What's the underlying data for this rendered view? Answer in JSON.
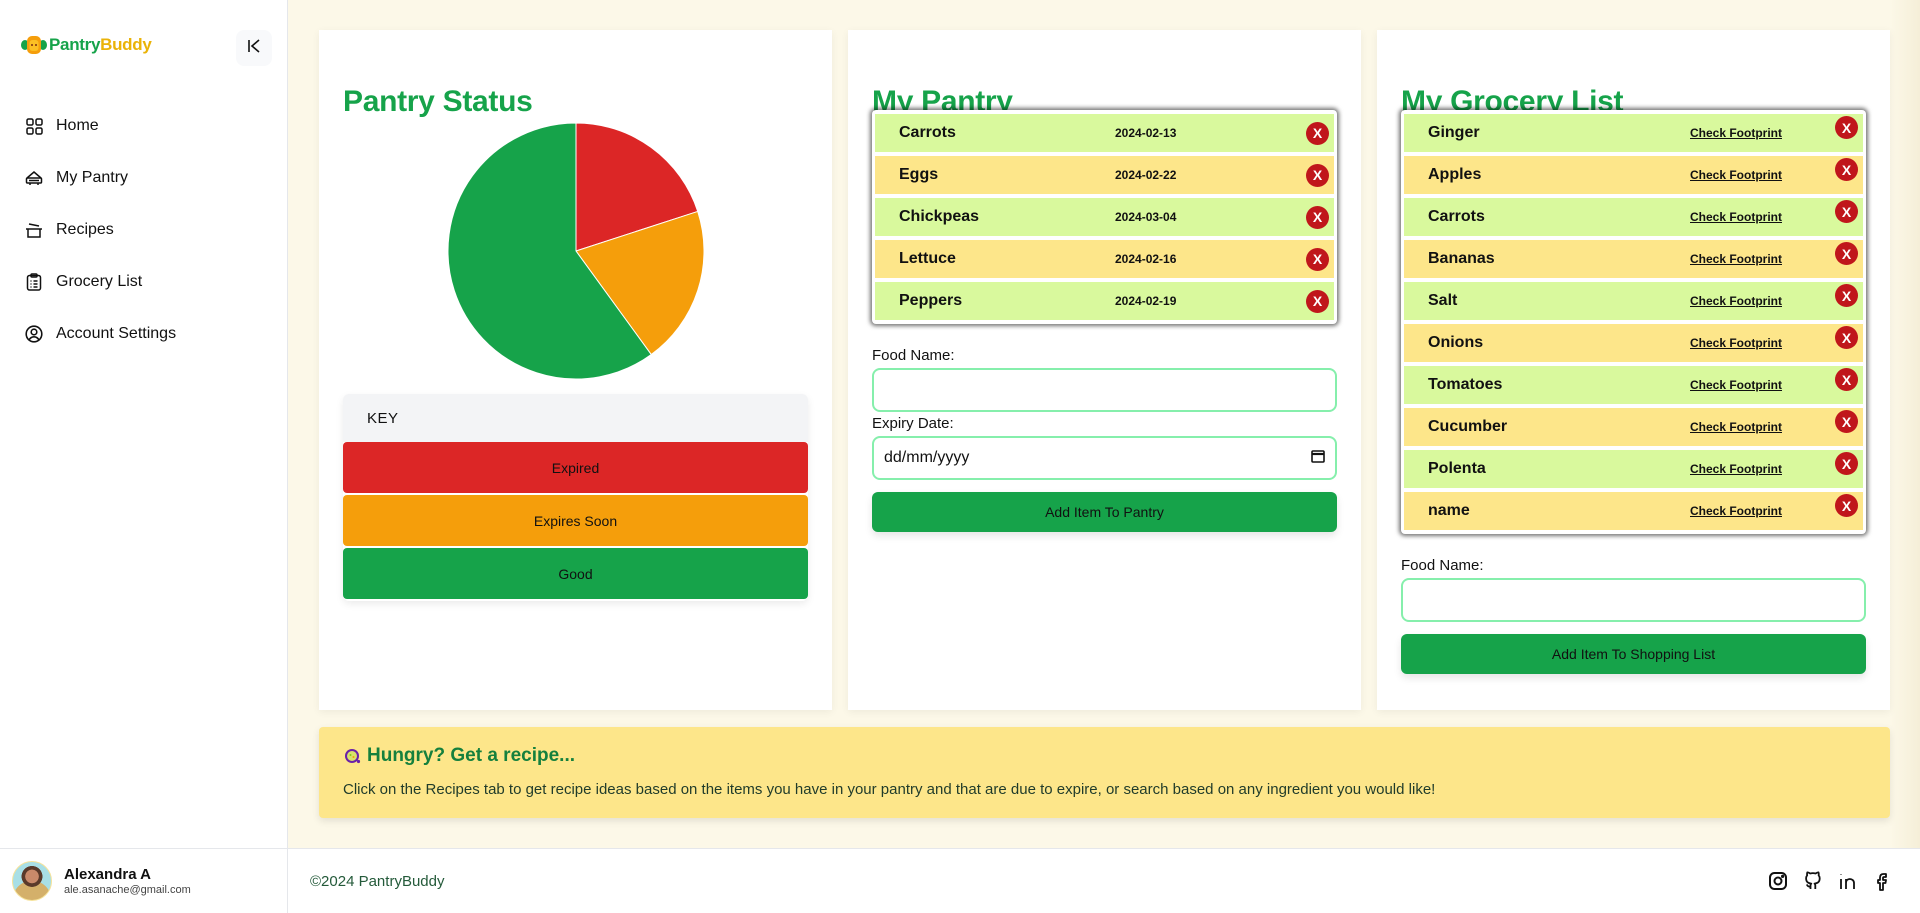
{
  "app": {
    "logo_part1": "Pantry",
    "logo_part2": "Buddy"
  },
  "sidebar": {
    "collapse_icon": "collapse-left-icon",
    "items": [
      {
        "label": "Home",
        "icon": "grid-icon"
      },
      {
        "label": "My Pantry",
        "icon": "pantry-icon"
      },
      {
        "label": "Recipes",
        "icon": "pot-icon"
      },
      {
        "label": "Grocery List",
        "icon": "clipboard-icon"
      },
      {
        "label": "Account Settings",
        "icon": "user-circle-icon"
      }
    ],
    "user": {
      "name": "Alexandra A",
      "email": "ale.asanache@gmail.com"
    }
  },
  "colors": {
    "brand_green": "#16a34a",
    "expired": "#dc2626",
    "expires_soon": "#f59e0b",
    "good": "#16a34a",
    "row_green": "#d9f99d",
    "row_yellow": "#fde68a",
    "delete": "#c0161b"
  },
  "status_card": {
    "title": "Pantry Status",
    "key_title": "KEY",
    "key": [
      {
        "label": "Expired"
      },
      {
        "label": "Expires Soon"
      },
      {
        "label": "Good"
      }
    ]
  },
  "chart_data": {
    "type": "pie",
    "title": "Pantry Status",
    "categories": [
      "Expired",
      "Expires Soon",
      "Good"
    ],
    "values": [
      1,
      1,
      3
    ],
    "colors": [
      "#dc2626",
      "#f59e0b",
      "#16a34a"
    ],
    "start_angle": "12 o'clock, clockwise",
    "legend": "below"
  },
  "pantry_card": {
    "title": "My Pantry",
    "items": [
      {
        "name": "Carrots",
        "date": "2024-02-13"
      },
      {
        "name": "Eggs",
        "date": "2024-02-22"
      },
      {
        "name": "Chickpeas",
        "date": "2024-03-04"
      },
      {
        "name": "Lettuce",
        "date": "2024-02-16"
      },
      {
        "name": "Peppers",
        "date": "2024-02-19"
      }
    ],
    "delete_label": "X",
    "food_name_label": "Food Name:",
    "food_name_value": "",
    "expiry_label": "Expiry Date:",
    "expiry_placeholder": "dd/mm/yyyy",
    "add_button": "Add Item To Pantry"
  },
  "grocery_card": {
    "title": "My Grocery List",
    "footprint_label": "Check Footprint",
    "delete_label": "X",
    "items": [
      {
        "name": "Ginger"
      },
      {
        "name": "Apples"
      },
      {
        "name": "Carrots"
      },
      {
        "name": "Bananas"
      },
      {
        "name": "Salt"
      },
      {
        "name": "Onions"
      },
      {
        "name": "Tomatoes"
      },
      {
        "name": "Cucumber"
      },
      {
        "name": "Polenta"
      },
      {
        "name": "name"
      }
    ],
    "food_name_label": "Food Name:",
    "food_name_value": "",
    "add_button": "Add Item To Shopping List"
  },
  "recipe_banner": {
    "icon": "recipe-bowl-icon",
    "title": "Hungry? Get a recipe...",
    "text": "Click on the Recipes tab to get recipe ideas based on the items you have in your pantry and that are due to expire, or search based on any ingredient you would like!"
  },
  "footer": {
    "copyright": "©2024 PantryBuddy",
    "socials": [
      "instagram-icon",
      "github-icon",
      "linkedin-icon",
      "facebook-icon"
    ]
  }
}
